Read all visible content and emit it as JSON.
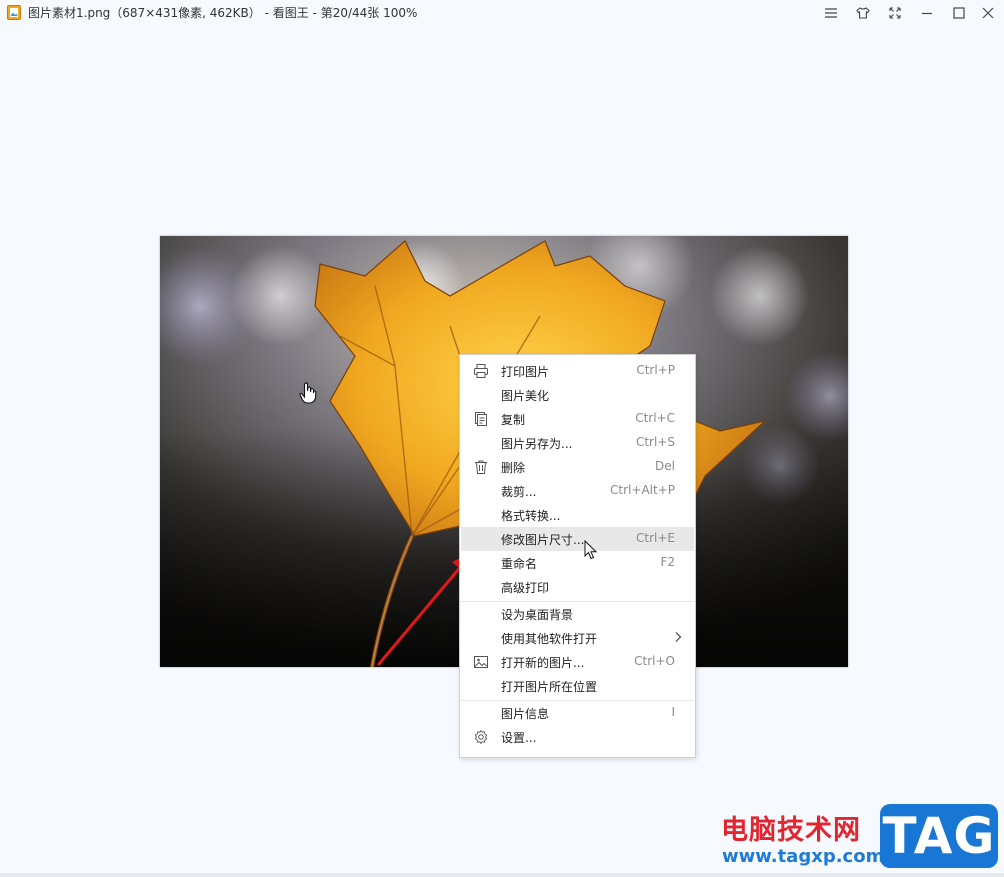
{
  "window": {
    "title": "图片素材1.png（687×431像素, 462KB） - 看图王 - 第20/44张 100%",
    "app_icon": "image-viewer-app-icon",
    "controls": [
      "menu-icon",
      "skin-icon",
      "fullscreen-icon",
      "minimize-icon",
      "maximize-icon",
      "close-icon"
    ]
  },
  "image": {
    "description_icon": "maple-leaf-photo"
  },
  "context_menu": {
    "items": [
      {
        "label": "打印图片",
        "shortcut": "Ctrl+P",
        "icon": "printer-icon"
      },
      {
        "label": "图片美化",
        "shortcut": "",
        "icon": ""
      },
      {
        "label": "复制",
        "shortcut": "Ctrl+C",
        "icon": "copy-icon"
      },
      {
        "label": "图片另存为...",
        "shortcut": "Ctrl+S",
        "icon": ""
      },
      {
        "label": "删除",
        "shortcut": "Del",
        "icon": "trash-icon"
      },
      {
        "label": "裁剪...",
        "shortcut": "Ctrl+Alt+P",
        "icon": ""
      },
      {
        "label": "格式转换...",
        "shortcut": "",
        "icon": ""
      },
      {
        "label": "修改图片尺寸...",
        "shortcut": "Ctrl+E",
        "icon": "",
        "highlighted": true
      },
      {
        "label": "重命名",
        "shortcut": "F2",
        "icon": ""
      },
      {
        "label": "高级打印",
        "shortcut": "",
        "icon": ""
      },
      {
        "label": "设为桌面背景",
        "shortcut": "",
        "icon": ""
      },
      {
        "label": "使用其他软件打开",
        "shortcut": "",
        "icon": "",
        "submenu": true
      },
      {
        "label": "打开新的图片...",
        "shortcut": "Ctrl+O",
        "icon": "picture-icon"
      },
      {
        "label": "打开图片所在位置",
        "shortcut": "",
        "icon": ""
      },
      {
        "label": "图片信息",
        "shortcut": "I",
        "icon": ""
      },
      {
        "label": "设置...",
        "shortcut": "",
        "icon": "gear-icon"
      }
    ]
  },
  "watermark": {
    "site_name": "电脑技术网",
    "url": "www.tagxp.com",
    "badge": "TAG"
  },
  "colors": {
    "background": "#f6fafe",
    "highlight": "#e8e8e8",
    "annotation_arrow": "#e01818",
    "watermark_red": "#e2252e",
    "watermark_blue": "#1877d4"
  }
}
